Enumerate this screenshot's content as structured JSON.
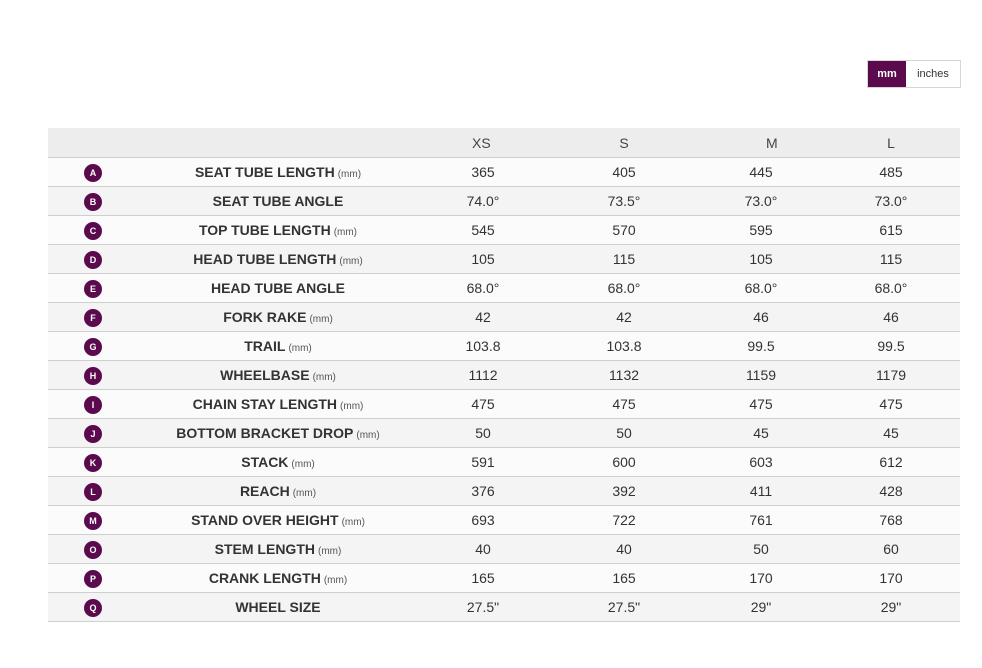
{
  "units": {
    "mm_label": "mm",
    "inches_label": "inches"
  },
  "table": {
    "sizes": [
      "XS",
      "S",
      "M",
      "L"
    ],
    "rows": [
      {
        "letter": "A",
        "name": "SEAT TUBE LENGTH",
        "unit": "(mm)",
        "values": [
          "365",
          "405",
          "445",
          "485"
        ]
      },
      {
        "letter": "B",
        "name": "SEAT TUBE ANGLE",
        "unit": "",
        "values": [
          "74.0°",
          "73.5°",
          "73.0°",
          "73.0°"
        ]
      },
      {
        "letter": "C",
        "name": "TOP TUBE LENGTH",
        "unit": "(mm)",
        "values": [
          "545",
          "570",
          "595",
          "615"
        ]
      },
      {
        "letter": "D",
        "name": "HEAD TUBE LENGTH",
        "unit": "(mm)",
        "values": [
          "105",
          "115",
          "105",
          "115"
        ]
      },
      {
        "letter": "E",
        "name": "HEAD TUBE ANGLE",
        "unit": "",
        "values": [
          "68.0°",
          "68.0°",
          "68.0°",
          "68.0°"
        ]
      },
      {
        "letter": "F",
        "name": "FORK RAKE",
        "unit": "(mm)",
        "values": [
          "42",
          "42",
          "46",
          "46"
        ]
      },
      {
        "letter": "G",
        "name": "TRAIL",
        "unit": "(mm)",
        "values": [
          "103.8",
          "103.8",
          "99.5",
          "99.5"
        ]
      },
      {
        "letter": "H",
        "name": "WHEELBASE",
        "unit": "(mm)",
        "values": [
          "1112",
          "1132",
          "1159",
          "1179"
        ]
      },
      {
        "letter": "I",
        "name": "CHAIN STAY LENGTH",
        "unit": "(mm)",
        "values": [
          "475",
          "475",
          "475",
          "475"
        ]
      },
      {
        "letter": "J",
        "name": "BOTTOM BRACKET DROP",
        "unit": "(mm)",
        "values": [
          "50",
          "50",
          "45",
          "45"
        ]
      },
      {
        "letter": "K",
        "name": "STACK",
        "unit": "(mm)",
        "values": [
          "591",
          "600",
          "603",
          "612"
        ]
      },
      {
        "letter": "L",
        "name": "REACH",
        "unit": "(mm)",
        "values": [
          "376",
          "392",
          "411",
          "428"
        ]
      },
      {
        "letter": "M",
        "name": "STAND OVER HEIGHT",
        "unit": "(mm)",
        "values": [
          "693",
          "722",
          "761",
          "768"
        ]
      },
      {
        "letter": "O",
        "name": "STEM LENGTH",
        "unit": "(mm)",
        "values": [
          "40",
          "40",
          "50",
          "60"
        ]
      },
      {
        "letter": "P",
        "name": "CRANK LENGTH",
        "unit": "(mm)",
        "values": [
          "165",
          "165",
          "170",
          "170"
        ]
      },
      {
        "letter": "Q",
        "name": "WHEEL SIZE",
        "unit": "",
        "values": [
          "27.5\"",
          "27.5\"",
          "29\"",
          "29\""
        ]
      }
    ]
  },
  "colors": {
    "accent": "#5b0a4e",
    "header_bg": "#ededed"
  }
}
